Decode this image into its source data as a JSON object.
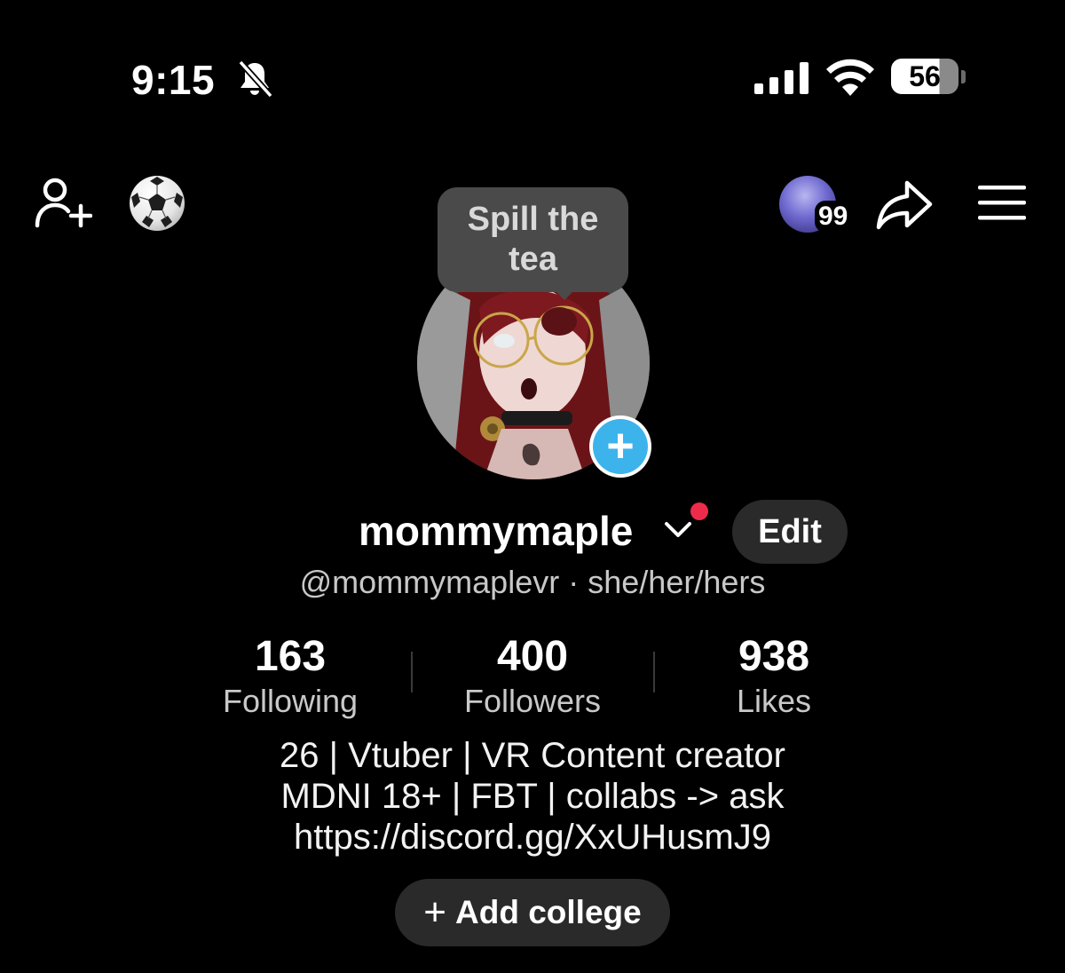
{
  "status_bar": {
    "time": "9:15",
    "battery": "56",
    "icons": [
      "bell-slash-icon",
      "cellular-signal-icon",
      "wifi-icon",
      "battery-icon"
    ]
  },
  "top_nav": {
    "left_icons": [
      "add-friend-icon",
      "soccer-ball-icon"
    ],
    "story_badge": "99",
    "right_icons": [
      "share-icon",
      "menu-icon"
    ]
  },
  "tooltip": {
    "line1": "Spill the",
    "line2": "tea"
  },
  "profile": {
    "display_name": "mommymaple",
    "edit_label": "Edit",
    "handle": "@mommymaplevr",
    "separator": "·",
    "pronouns": "she/her/hers",
    "add_photo_symbol": "+"
  },
  "stats": [
    {
      "value": "163",
      "label": "Following"
    },
    {
      "value": "400",
      "label": "Followers"
    },
    {
      "value": "938",
      "label": "Likes"
    }
  ],
  "bio": {
    "lines": [
      "26 | Vtuber | VR Content creator",
      "MDNI 18+ | FBT | collabs -> ask",
      "https://discord.gg/XxUHusmJ9"
    ]
  },
  "add_college": {
    "symbol": "+",
    "label": "Add college"
  },
  "colors": {
    "background": "#000000",
    "accent_blue": "#3db3ec",
    "notification_red": "#ee2b4b",
    "pill_gray": "#2a2a2a",
    "tooltip_gray": "#4a4a4a"
  }
}
